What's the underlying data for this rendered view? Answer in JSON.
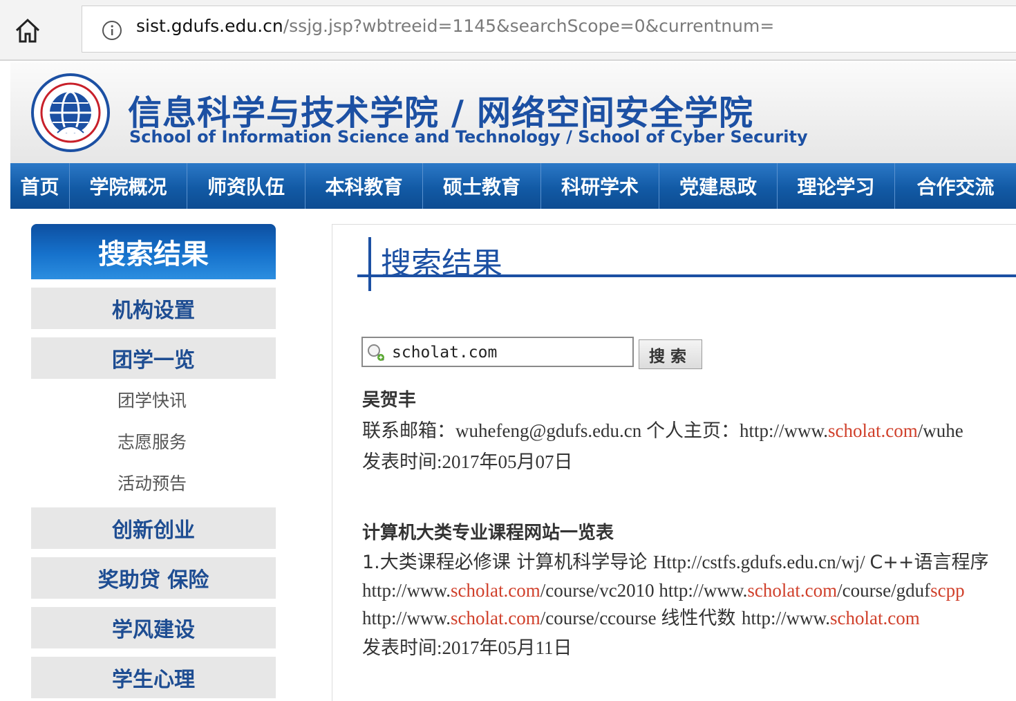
{
  "browser": {
    "url_host": "sist.gdufs.edu.cn",
    "url_path": "/ssjg.jsp?wbtreeid=1145&searchScope=0&currentnum="
  },
  "header": {
    "title_cn": "信息科学与技术学院 / 网络空间安全学院",
    "title_en": "School of Information Science and Technology / School of Cyber Security"
  },
  "nav": {
    "items": [
      "首页",
      "学院概况",
      "师资队伍",
      "本科教育",
      "硕士教育",
      "科研学术",
      "党建思政",
      "理论学习",
      "合作交流"
    ]
  },
  "sidebar": {
    "heading": "搜索结果",
    "items": [
      {
        "label": "机构设置",
        "type": "main"
      },
      {
        "label": "团学一览",
        "type": "main"
      },
      {
        "label": "团学快讯",
        "type": "sub"
      },
      {
        "label": "志愿服务",
        "type": "sub"
      },
      {
        "label": "活动预告",
        "type": "sub"
      },
      {
        "label": "创新创业",
        "type": "main"
      },
      {
        "label": "奖助贷 保险",
        "type": "main"
      },
      {
        "label": "学风建设",
        "type": "main"
      },
      {
        "label": "学生心理",
        "type": "main"
      }
    ]
  },
  "main": {
    "title": "搜索结果",
    "search": {
      "value": "scholat.com",
      "button": "搜索"
    },
    "results": [
      {
        "title": "吴贺丰",
        "email_label": "联系邮箱：",
        "email": "wuhefeng@gdufs.edu.cn",
        "home_label": "个人主页：",
        "home_prefix": "http://www.",
        "home_hl": "scholat.com",
        "home_suffix": "/wuhe",
        "date": "发表时间:2017年05月07日"
      },
      {
        "title": "计算机大类专业课程网站一览表",
        "line1_a": "1.大类课程必修课 计算机科学导论 ",
        "line1_b": "Http://cstfs.gdufs.edu.cn/wj/ ",
        "line1_c": "C++语言程序",
        "line2_a": "http://www.",
        "line2_b": "scholat.com",
        "line2_c": "/course/vc2010 http://www.",
        "line2_d": "scholat.com",
        "line2_e": "/course/gduf",
        "line2_f": "scpp",
        "line3_a": "http://www.",
        "line3_b": "scholat.com",
        "line3_c": "/course/ccourse ",
        "line3_d": "线性代数 ",
        "line3_e": "http://www.",
        "line3_f": "scholat.com",
        "date": "发表时间:2017年05月11日"
      }
    ]
  }
}
